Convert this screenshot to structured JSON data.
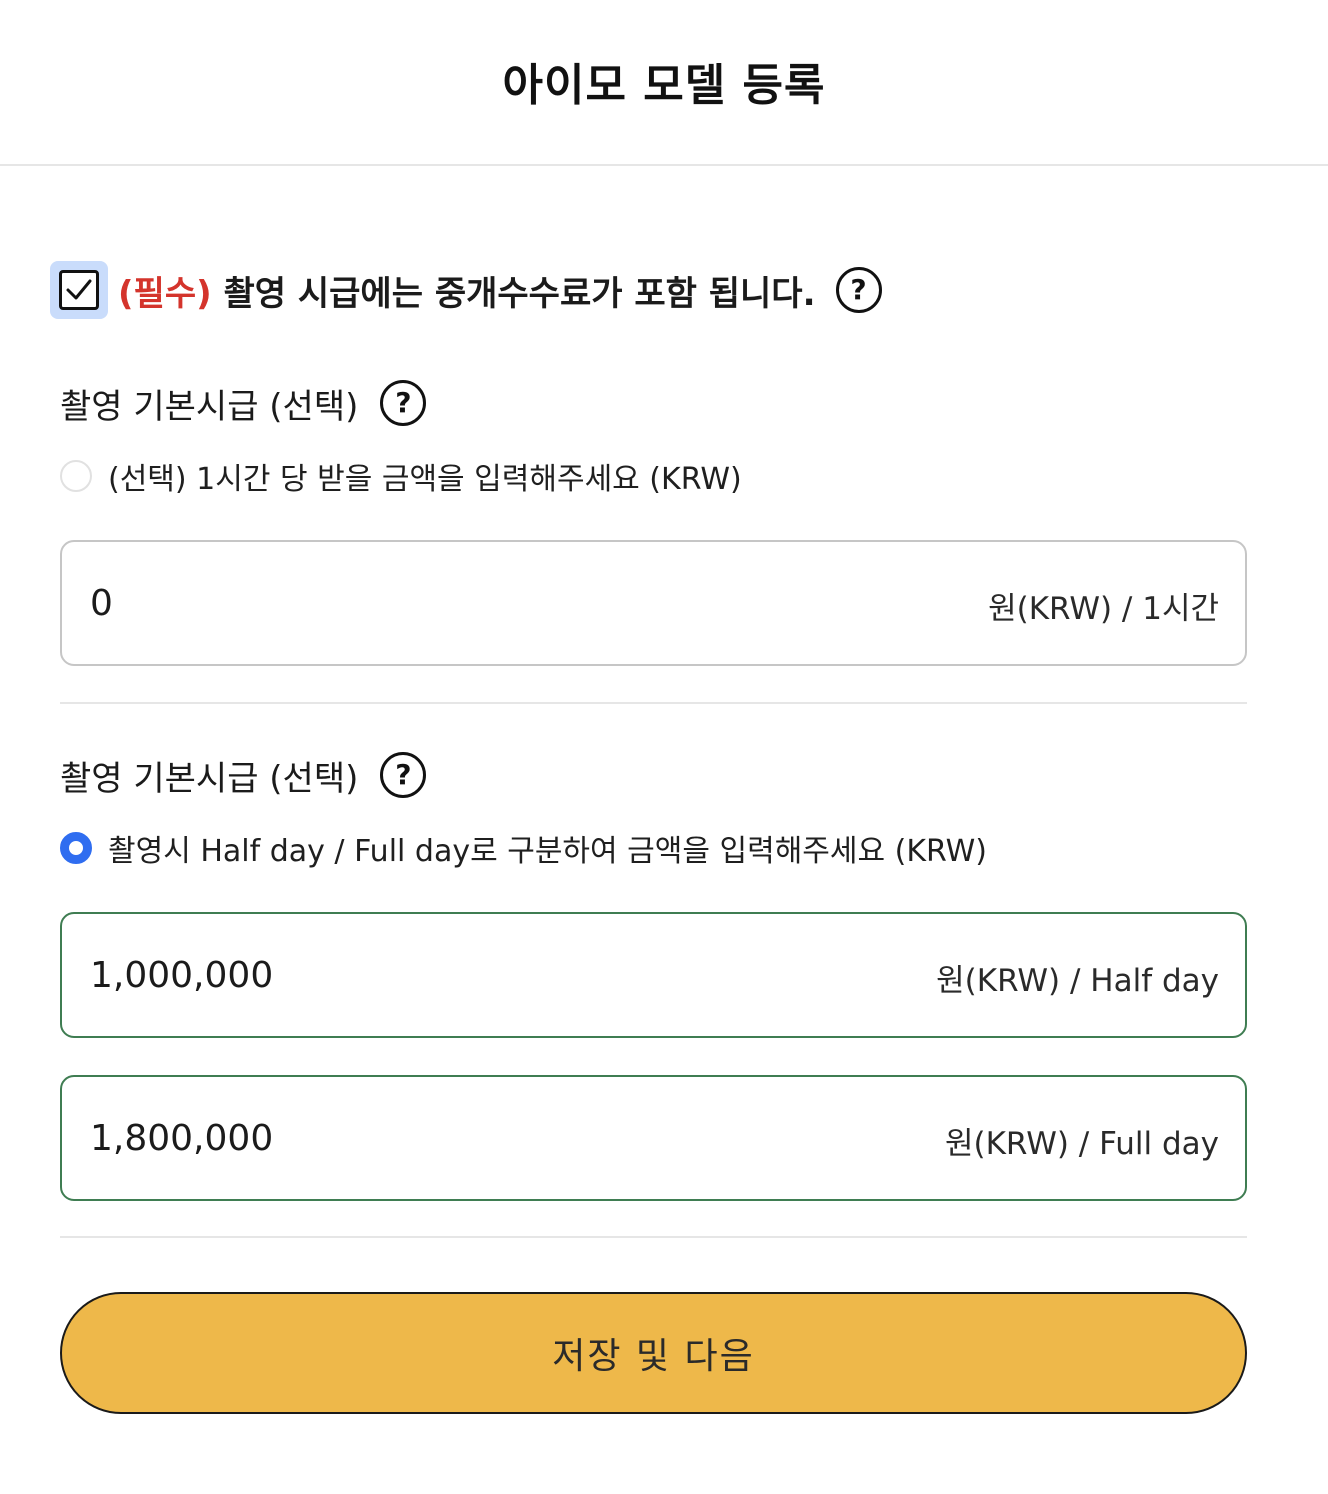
{
  "header": {
    "title": "아이모 모델 등록"
  },
  "required_notice": {
    "checked": true,
    "tag": "(필수)",
    "text": " 촬영 시급에는 중개수수료가 포함 됩니다.",
    "help_icon": "question-circle-icon"
  },
  "hourly_section": {
    "title": "촬영 기본시급 (선택)",
    "help_icon": "question-circle-icon",
    "radio_label": "(선택) 1시간 당 받을 금액을 입력해주세요 (KRW)",
    "radio_selected": false,
    "field": {
      "value": "0",
      "unit": "원(KRW) / 1시간"
    }
  },
  "daily_section": {
    "title": "촬영 기본시급 (선택)",
    "help_icon": "question-circle-icon",
    "radio_label": "촬영시 Half day / Full day로 구분하여 금액을 입력해주세요 (KRW)",
    "radio_selected": true,
    "half_day": {
      "value": "1,000,000",
      "unit": "원(KRW) / Half day"
    },
    "full_day": {
      "value": "1,800,000",
      "unit": "원(KRW) / Full day"
    }
  },
  "footer": {
    "save_label": "저장 및 다음"
  },
  "colors": {
    "required_tag": "#d4342c",
    "radio_selected": "#2f6df0",
    "checkbox_highlight": "#c9dcfb",
    "active_border": "#3f7d52",
    "save_button": "#eeb84a"
  }
}
